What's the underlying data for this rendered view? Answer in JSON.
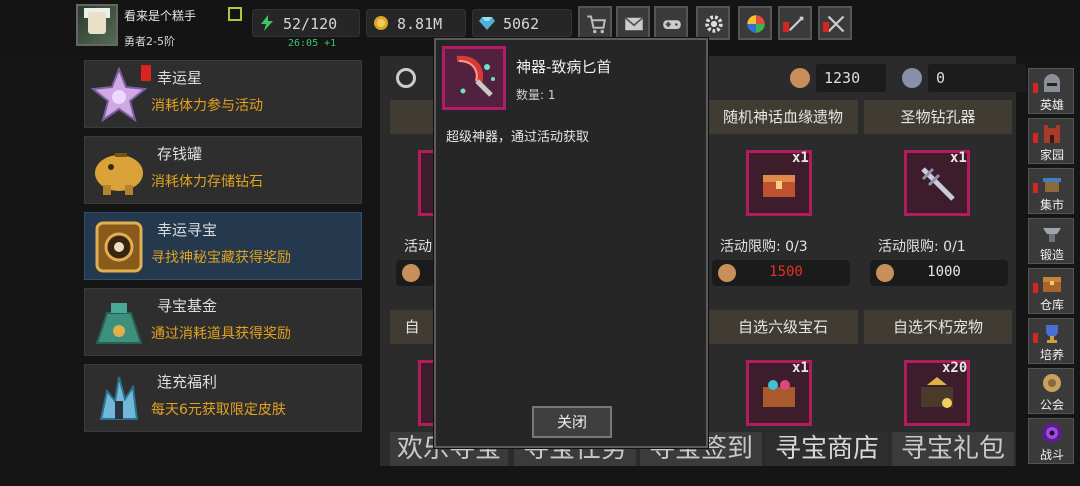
{
  "player": {
    "name": "看来是个糕手",
    "rank": "勇者2-5阶",
    "stamina": "52/120",
    "stamina_timer": "26:05 +1",
    "gold": "8.81M",
    "gems": "5062"
  },
  "toolbar": {
    "icons": [
      "shop-cart-icon",
      "mail-icon",
      "gamepad-icon",
      "gear-icon",
      "color-wheel-icon",
      "sword-alert-icon",
      "crossed-swords-alert-icon"
    ]
  },
  "activities": [
    {
      "title": "幸运星",
      "subtitle": "消耗体力参与活动"
    },
    {
      "title": "存钱罐",
      "subtitle": "消耗体力存储钻石"
    },
    {
      "title": "幸运寻宝",
      "subtitle": "寻找神秘宝藏获得奖励"
    },
    {
      "title": "寻宝基金",
      "subtitle": "通过消耗道具获得奖励"
    },
    {
      "title": "连充福利",
      "subtitle": "每天6元获取限定皮肤"
    }
  ],
  "shop": {
    "currency_1": "1230",
    "currency_2": "0",
    "row1": [
      {
        "name": "随机神话血缘遗物",
        "qty": "x1",
        "limit": "活动限购: 0/3",
        "price": "1500"
      },
      {
        "name": "圣物钻孔器",
        "qty": "x1",
        "limit": "活动限购: 0/1",
        "price": "1000"
      }
    ],
    "left_partial": {
      "limit_prefix": "活动",
      "head_prefix": "自"
    },
    "row2": [
      {
        "name": "自选六级宝石",
        "qty": "x1"
      },
      {
        "name": "自选不朽宠物",
        "qty": "x20"
      }
    ],
    "tabs": [
      "欢乐寻宝",
      "寻宝任务",
      "寻宝签到",
      "寻宝商店",
      "寻宝礼包"
    ]
  },
  "nav": [
    {
      "label": "英雄"
    },
    {
      "label": "家园"
    },
    {
      "label": "集市"
    },
    {
      "label": "锻造"
    },
    {
      "label": "仓库"
    },
    {
      "label": "培养"
    },
    {
      "label": "公会"
    },
    {
      "label": "战斗"
    }
  ],
  "modal": {
    "title": "神器-致病匕首",
    "count_label": "数量: 1",
    "description": "超级神器，通过活动获取",
    "close_label": "关闭"
  },
  "colors": {
    "accent_orange": "#e0a21f",
    "price_red": "#e0332b",
    "timer_green": "#39c66b",
    "rare_border": "#b01c5c",
    "selected_card": "#24384e"
  }
}
